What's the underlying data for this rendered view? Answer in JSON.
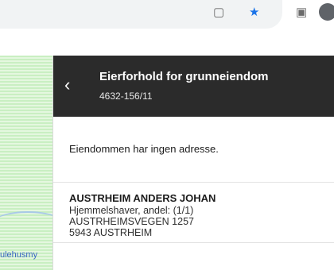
{
  "panel": {
    "title": "Eierforhold for grunneiendom",
    "subtitle": "4632-156/11",
    "info": "Eiendommen har ingen adresse.",
    "owners": [
      {
        "name": "AUSTRHEIM ANDERS JOHAN",
        "role": "Hjemmelshaver, andel: (1/1)",
        "street": "AUSTRHEIMSVEGEN 1257",
        "postal": "5943 AUSTRHEIM"
      }
    ]
  },
  "map": {
    "label": "ulehusmy"
  },
  "icons": {
    "back": "chevron-left-icon",
    "bookmark": "star-icon"
  }
}
